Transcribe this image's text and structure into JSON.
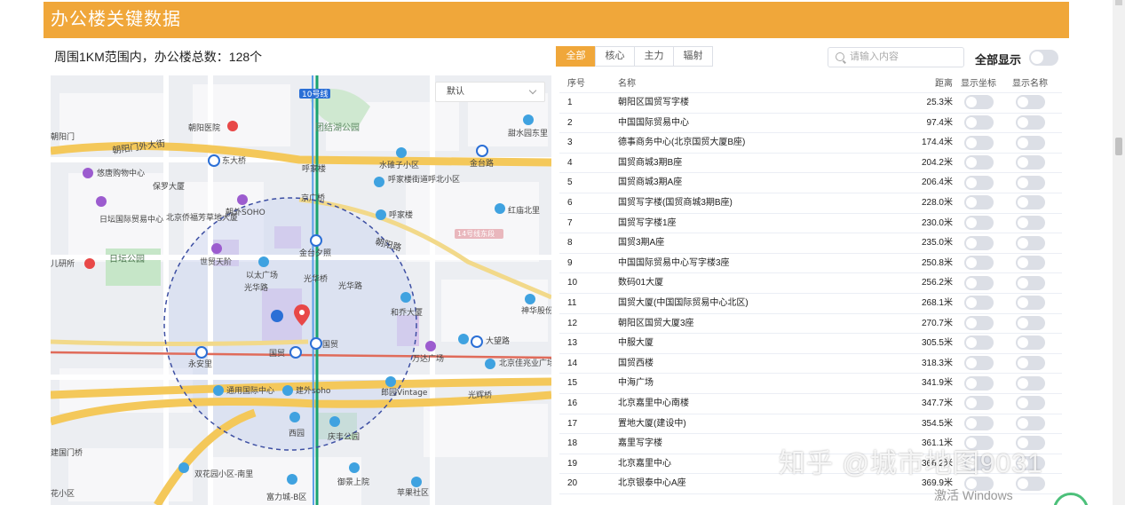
{
  "header": {
    "title": "办公楼关键数据"
  },
  "summary": {
    "text": "周围1KM范围内，办公楼总数：128个"
  },
  "tabs": [
    {
      "label": "全部",
      "active": true
    },
    {
      "label": "核心",
      "active": false
    },
    {
      "label": "主力",
      "active": false
    },
    {
      "label": "辐射",
      "active": false
    }
  ],
  "search": {
    "placeholder": "请输入内容"
  },
  "show_all": {
    "label": "全部显示",
    "on": false
  },
  "map": {
    "select_value": "默认",
    "labels": [
      "10号线",
      "团结湖公园",
      "朝阳医院",
      "甜水园东里",
      "朝阳门外大街",
      "东大桥",
      "呼家楼",
      "水碓子小区",
      "金台路",
      "悠唐购物中心",
      "保罗大厦",
      "呼家楼街道呼北小区",
      "京广桥",
      "日坛国际贸易中心",
      "北京侨福芳草地大厦",
      "朝外SOHO",
      "呼家楼",
      "红庙北里",
      "14号线东段",
      "朝阳路",
      "金台夕照",
      "世贸天阶",
      "以太广场",
      "光华路",
      "光华桥",
      "光华路",
      "和乔大厦",
      "日坛公园",
      "儿研所",
      "国贸",
      "国贸",
      "大望路",
      "永安里",
      "万达广场",
      "北京佳兆业广场",
      "通用国际中心",
      "建外soho",
      "郎园Vintage",
      "光辉桥",
      "西园",
      "庆丰公园",
      "双花园小区-南里",
      "御景上院",
      "苹果社区",
      "富力城-B区",
      "神华股份",
      "朝阳门",
      "建国门桥",
      "花小区"
    ]
  },
  "table": {
    "headers": {
      "idx": "序号",
      "name": "名称",
      "dist": "距离",
      "show_coord": "显示坐标",
      "show_name": "显示名称"
    },
    "rows": [
      {
        "idx": "1",
        "name": "朝阳区国贸写字楼",
        "dist": "25.3米"
      },
      {
        "idx": "2",
        "name": "中国国际贸易中心",
        "dist": "97.4米"
      },
      {
        "idx": "3",
        "name": "德事商务中心(北京国贸大厦B座)",
        "dist": "174.4米"
      },
      {
        "idx": "4",
        "name": "国贸商城3期B座",
        "dist": "204.2米"
      },
      {
        "idx": "5",
        "name": "国贸商城3期A座",
        "dist": "206.4米"
      },
      {
        "idx": "6",
        "name": "国贸写字楼(国贸商城3期B座)",
        "dist": "228.0米"
      },
      {
        "idx": "7",
        "name": "国贸写字楼1座",
        "dist": "230.0米"
      },
      {
        "idx": "8",
        "name": "国贸3期A座",
        "dist": "235.0米"
      },
      {
        "idx": "9",
        "name": "中国国际贸易中心写字楼3座",
        "dist": "250.8米"
      },
      {
        "idx": "10",
        "name": "数码01大厦",
        "dist": "256.2米"
      },
      {
        "idx": "11",
        "name": "国贸大厦(中国国际贸易中心北区)",
        "dist": "268.1米"
      },
      {
        "idx": "12",
        "name": "朝阳区国贸大厦3座",
        "dist": "270.7米"
      },
      {
        "idx": "13",
        "name": "中服大厦",
        "dist": "305.5米"
      },
      {
        "idx": "14",
        "name": "国贸西楼",
        "dist": "318.3米"
      },
      {
        "idx": "15",
        "name": "中海广场",
        "dist": "341.9米"
      },
      {
        "idx": "16",
        "name": "北京嘉里中心南楼",
        "dist": "347.7米"
      },
      {
        "idx": "17",
        "name": "置地大厦(建设中)",
        "dist": "354.5米"
      },
      {
        "idx": "18",
        "name": "嘉里写字楼",
        "dist": "361.1米"
      },
      {
        "idx": "19",
        "name": "北京嘉里中心",
        "dist": "366.2米"
      },
      {
        "idx": "20",
        "name": "北京银泰中心A座",
        "dist": "369.9米"
      }
    ]
  },
  "overlay": {
    "watermark": "知乎 @城市地图9031",
    "activate": "激活 Windows"
  },
  "colors": {
    "accent": "#f0a73a",
    "circle": "#3d4fa3",
    "metro_green": "#1aa36f",
    "metro_blue": "#2b6fd6"
  }
}
